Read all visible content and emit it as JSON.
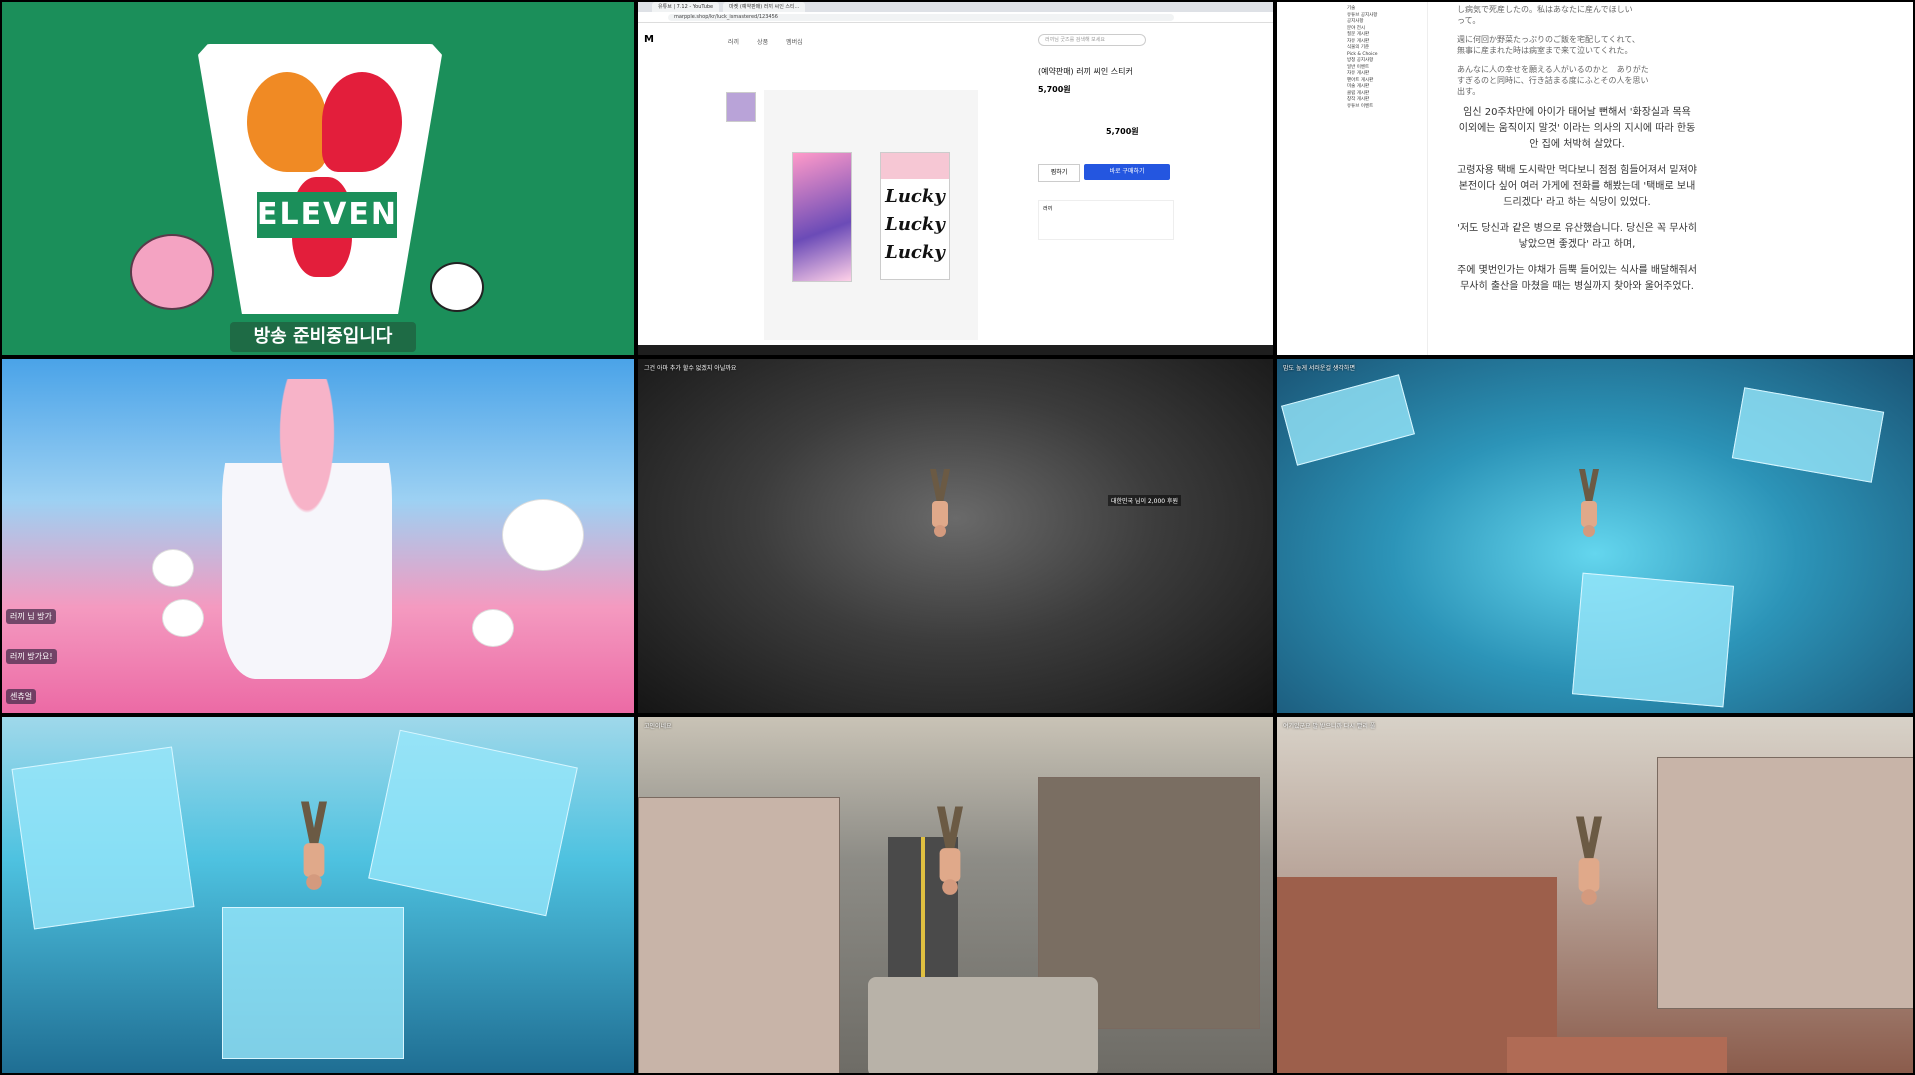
{
  "standby": {
    "logo_text": "ELEVEN",
    "banner": "방송 준비중입니다"
  },
  "browser": {
    "tabs": [
      "유튜브 | 7.12 - YouTube",
      "마켓 (예약판매) 러끼 씨인 스티..."
    ],
    "url": "marpple.shop/kr/luck_ismastered/123456",
    "logo": "M",
    "nav": [
      "러끼",
      "상품",
      "멤버십"
    ],
    "search_placeholder": "러끼님 굿즈를 검색해 보세요",
    "product_title": "(예약판매) 러끼 씨인 스티커",
    "price": "5,700원",
    "total": "5,700원",
    "buy_label": "바로 구매하기",
    "like_label": "찜하기",
    "sticker_text": "Lucky",
    "profile_name": "러끼"
  },
  "novel": {
    "side_items": [
      "기술",
      "유튜브 공지사항",
      "공지사항",
      "분야 전시",
      "질문 게시판",
      "자유 게시판",
      "식물의 기준",
      "Pick & Choice",
      "방청 공지사항",
      "일반 이벤트",
      "자유 게시판",
      "팬아트 게시판",
      "미술 게시판",
      "클립 게시판",
      "창작 게시판",
      "유튜브 이벤트"
    ],
    "jp_lines": [
      "し病気で死産したの。私はあなたに産んでほしい",
      "って。",
      "週に何回か野菜たっぷりのご飯を宅配してくれて、",
      "無事に産まれた時は病室まで来て泣いてくれた。",
      "あんなに人の幸せを願える人がいるのかと　ありがた",
      "すぎるのと同時に、行き詰まる度にふとその人を思い",
      "出す。"
    ],
    "ko_paragraphs": [
      "임신 20주차만에 아이가 태어날 뻔해서 '화장실과 목욕 이외에는 움직이지 말것' 이라는 의사의 지시에 따라 한동안 집에 처박혀 살았다.",
      "고령자용 택배 도시락만 먹다보니 점점 힘들어져서 밑져야 본전이다 싶어 여러 가게에 전화를 해봤는데 '택배로 보내드리겠다' 라고 하는 식당이 있었다.",
      "'저도 당신과 같은 병으로 유산했습니다. 당신은 꼭 무사히 낳았으면 좋겠다' 라고 하며,",
      "주에 몇번인가는 야채가 듬뿍 들어있는 식사를 배달해줘서 무사히 출산을 마쳤을 때는 병실까지 찾아와 울어주었다."
    ]
  },
  "art": {
    "chat": [
      "러끼 님 방가",
      "러끼 방가요!",
      "센츄얼"
    ]
  },
  "dark_game": {
    "caption": "그건 아마 추가 할수 없겠지 아닐까요",
    "donation": "대한민국 님이 2,000 후원"
  },
  "ice1": {
    "caption": "맘도 높게 서러운걸 생각하면"
  },
  "ice2": {
    "caption": ""
  },
  "city1": {
    "caption": "고인이네요"
  },
  "city2": {
    "caption": "여기있군요 발 받으니까 다시 빨리 풀"
  }
}
